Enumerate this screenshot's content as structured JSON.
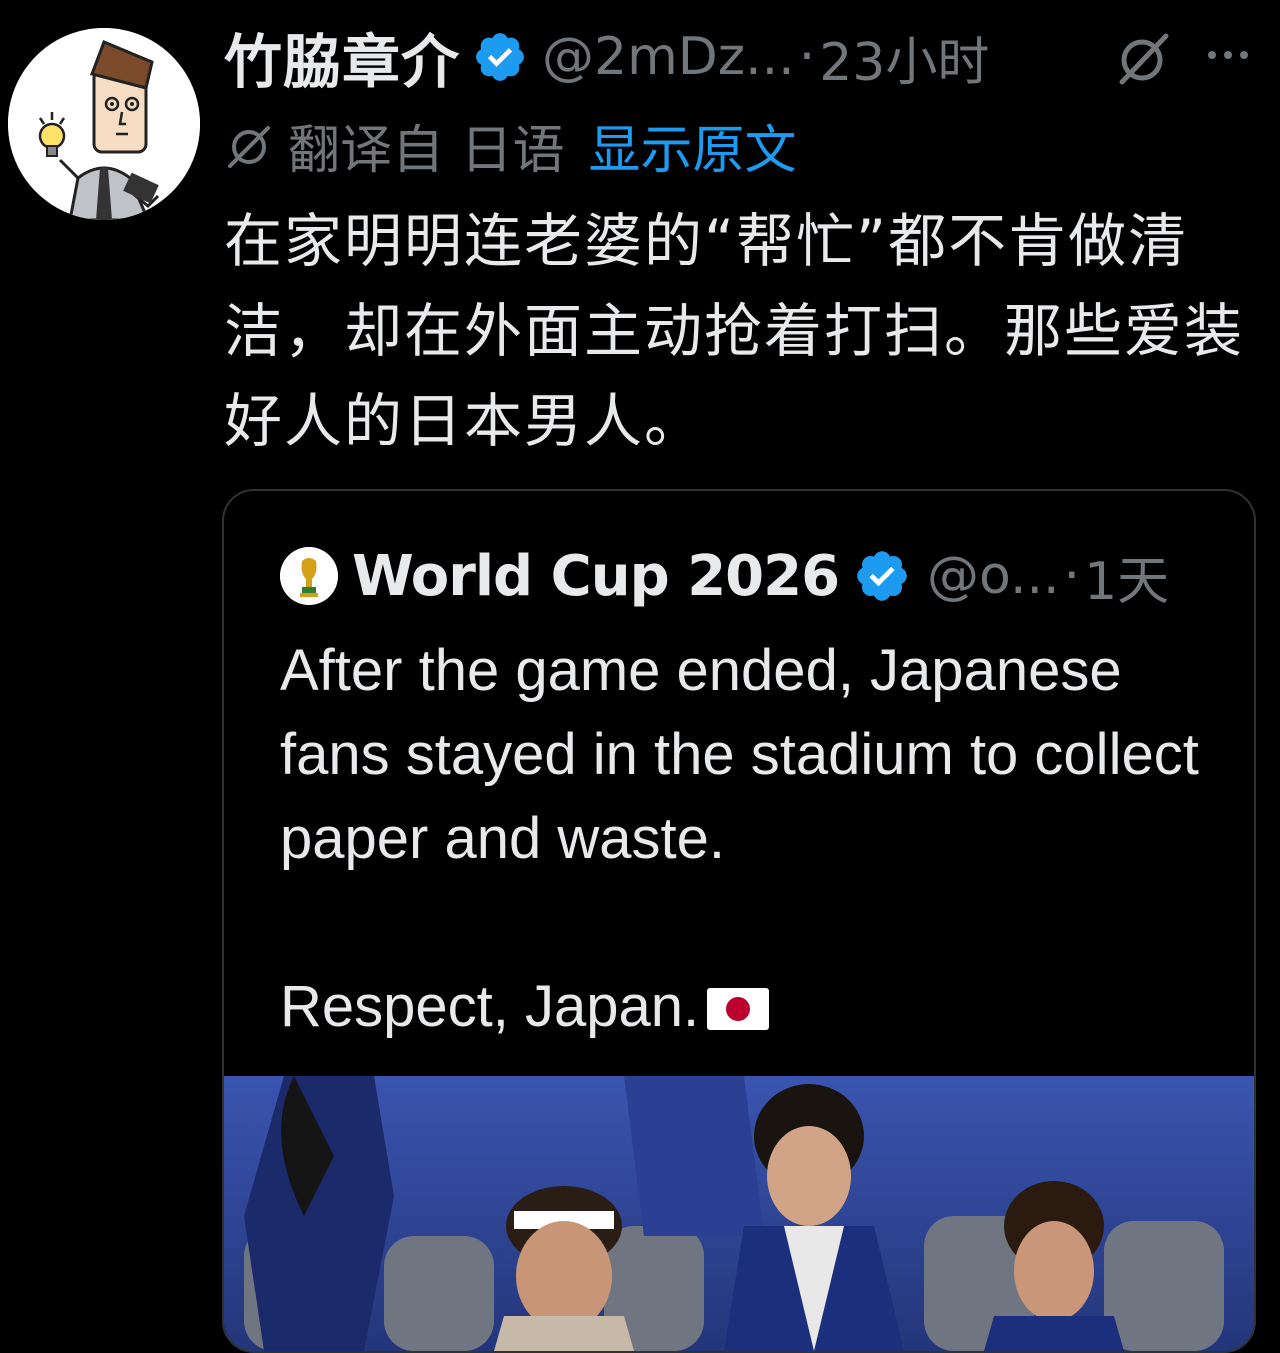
{
  "tweet": {
    "display_name": "竹脇章介",
    "handle": "@2mDz...",
    "separator": "·",
    "time": "23小时",
    "translation": {
      "label": "翻译自 日语",
      "show_original": "显示原文"
    },
    "text": "在家明明连老婆的“帮忙”都不肯做清洁，却在外面主动抢着打扫。那些爱装好人的日本男人。"
  },
  "quote": {
    "display_name": "World Cup 2026",
    "handle": "@o...",
    "separator": "·",
    "time": "1天",
    "text_lines": [
      "After the game ended, Japanese fans stayed in the stadium to collect paper and waste.",
      "Respect, Japan."
    ]
  },
  "icons": {
    "verified": "verified-badge-icon",
    "grok": "grok-icon",
    "more": "more-icon",
    "translate": "translate-icon"
  },
  "colors": {
    "background": "#000000",
    "text_primary": "#e7e9ea",
    "text_secondary": "#71767b",
    "link": "#1d9bf0",
    "verified": "#1d9bf0",
    "border": "#2f3336"
  }
}
